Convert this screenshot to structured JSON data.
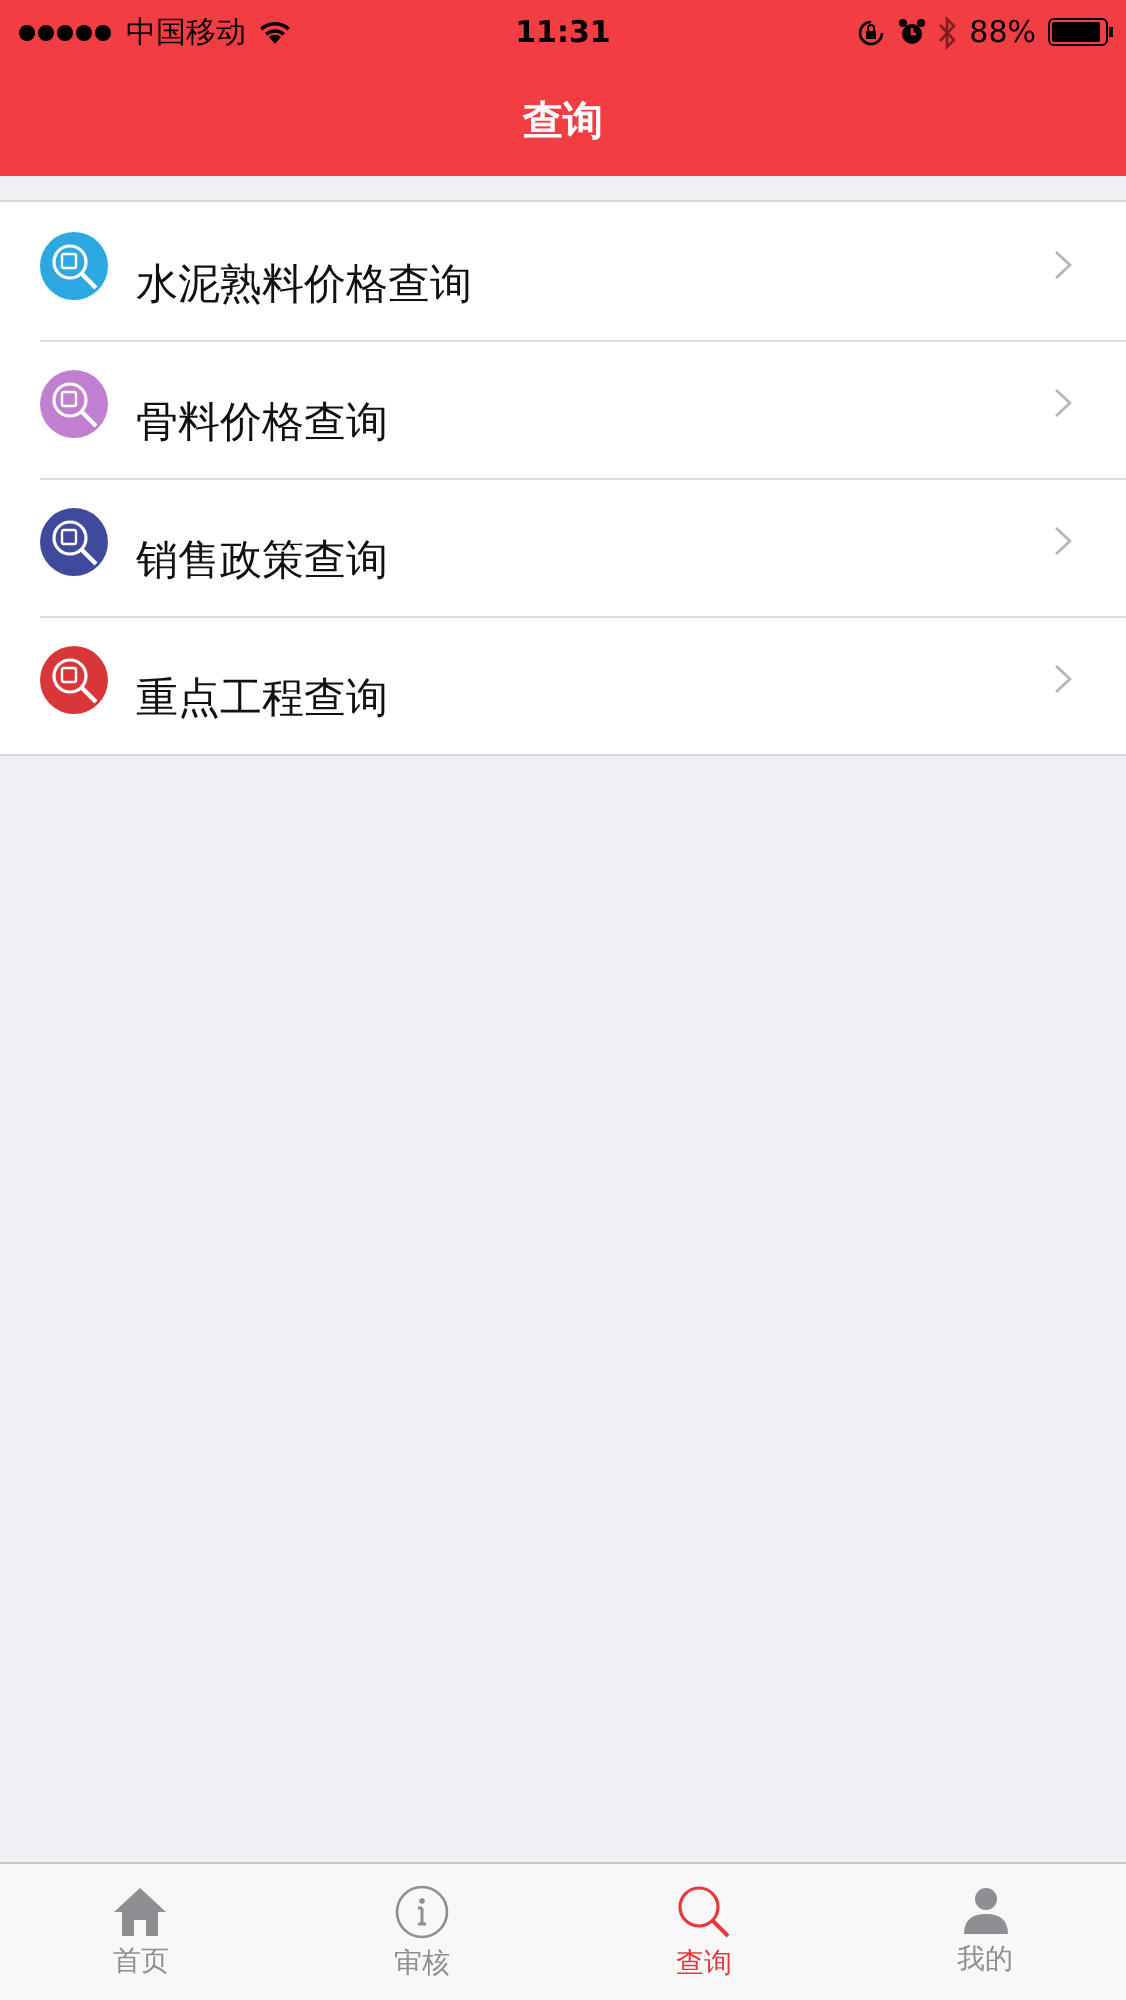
{
  "status_bar": {
    "carrier": "中国移动",
    "time": "11:31",
    "battery": "88%"
  },
  "nav": {
    "title": "查询"
  },
  "items": [
    {
      "label": "水泥熟料价格查询",
      "color": "#2ea8e0"
    },
    {
      "label": "骨料价格查询",
      "color": "#c07fd0"
    },
    {
      "label": "销售政策查询",
      "color": "#3f4a9e"
    },
    {
      "label": "重点工程查询",
      "color": "#d9363a"
    }
  ],
  "tabs": [
    {
      "label": "首页",
      "kind": "home",
      "selected": false
    },
    {
      "label": "审核",
      "kind": "info",
      "selected": false
    },
    {
      "label": "查询",
      "kind": "search",
      "selected": true
    },
    {
      "label": "我的",
      "kind": "user",
      "selected": false
    }
  ]
}
